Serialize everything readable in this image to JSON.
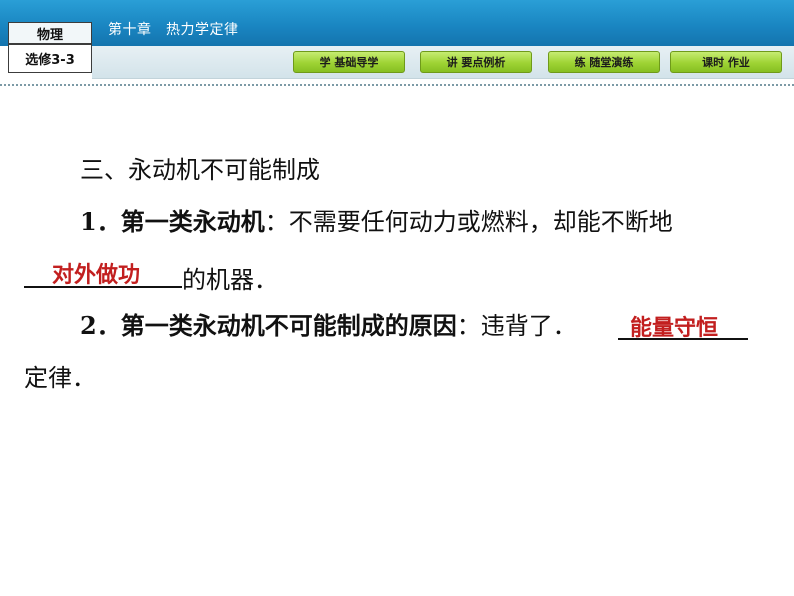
{
  "header": {
    "subject": "物理",
    "book": "选修3-3",
    "chapter_title": "第十章　热力学定律"
  },
  "nav": {
    "items": [
      {
        "label": "学 基础导学"
      },
      {
        "label": "讲 要点例析"
      },
      {
        "label": "练 随堂演练"
      },
      {
        "label": "课时 作业"
      }
    ]
  },
  "content": {
    "heading": "三、永动机不可能制成",
    "item1": {
      "number": "1．",
      "term": "第一类永动机",
      "text": "：不需要任何动力或燃料，却能不断地",
      "answer": "对外做功",
      "tail": "的机器．"
    },
    "item2": {
      "number": "2．",
      "term": "第一类永动机不可能制成的原因",
      "text": "：违背了．",
      "answer": "能量守恒",
      "tail": "定律．"
    }
  }
}
